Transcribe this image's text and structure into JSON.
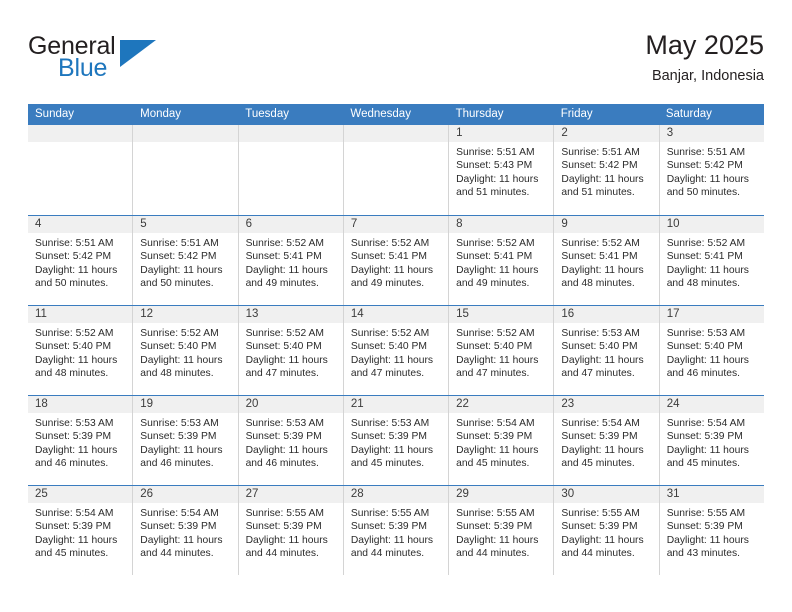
{
  "logo": {
    "word_top": "General",
    "word_bottom": "Blue",
    "flag_icon": "blue-triangle-flag-icon",
    "brand_color": "#1e76bd"
  },
  "header": {
    "title": "May 2025",
    "subtitle": "Banjar, Indonesia"
  },
  "theme": {
    "header_blue": "#3a7cbf",
    "daynum_band": "#f0f0f0",
    "grid_line": "#d4d4d4",
    "text": "#2b2b2b"
  },
  "weekdays": [
    "Sunday",
    "Monday",
    "Tuesday",
    "Wednesday",
    "Thursday",
    "Friday",
    "Saturday"
  ],
  "labels": {
    "sunrise_prefix": "Sunrise:",
    "sunset_prefix": "Sunset:",
    "daylight_prefix": "Daylight:"
  },
  "weeks": [
    [
      {
        "day": "",
        "empty": true
      },
      {
        "day": "",
        "empty": true
      },
      {
        "day": "",
        "empty": true
      },
      {
        "day": "",
        "empty": true
      },
      {
        "day": "1",
        "sunrise": "Sunrise: 5:51 AM",
        "sunset": "Sunset: 5:43 PM",
        "daylight_line1": "Daylight: 11 hours",
        "daylight_line2": "and 51 minutes."
      },
      {
        "day": "2",
        "sunrise": "Sunrise: 5:51 AM",
        "sunset": "Sunset: 5:42 PM",
        "daylight_line1": "Daylight: 11 hours",
        "daylight_line2": "and 51 minutes."
      },
      {
        "day": "3",
        "sunrise": "Sunrise: 5:51 AM",
        "sunset": "Sunset: 5:42 PM",
        "daylight_line1": "Daylight: 11 hours",
        "daylight_line2": "and 50 minutes."
      }
    ],
    [
      {
        "day": "4",
        "sunrise": "Sunrise: 5:51 AM",
        "sunset": "Sunset: 5:42 PM",
        "daylight_line1": "Daylight: 11 hours",
        "daylight_line2": "and 50 minutes."
      },
      {
        "day": "5",
        "sunrise": "Sunrise: 5:51 AM",
        "sunset": "Sunset: 5:42 PM",
        "daylight_line1": "Daylight: 11 hours",
        "daylight_line2": "and 50 minutes."
      },
      {
        "day": "6",
        "sunrise": "Sunrise: 5:52 AM",
        "sunset": "Sunset: 5:41 PM",
        "daylight_line1": "Daylight: 11 hours",
        "daylight_line2": "and 49 minutes."
      },
      {
        "day": "7",
        "sunrise": "Sunrise: 5:52 AM",
        "sunset": "Sunset: 5:41 PM",
        "daylight_line1": "Daylight: 11 hours",
        "daylight_line2": "and 49 minutes."
      },
      {
        "day": "8",
        "sunrise": "Sunrise: 5:52 AM",
        "sunset": "Sunset: 5:41 PM",
        "daylight_line1": "Daylight: 11 hours",
        "daylight_line2": "and 49 minutes."
      },
      {
        "day": "9",
        "sunrise": "Sunrise: 5:52 AM",
        "sunset": "Sunset: 5:41 PM",
        "daylight_line1": "Daylight: 11 hours",
        "daylight_line2": "and 48 minutes."
      },
      {
        "day": "10",
        "sunrise": "Sunrise: 5:52 AM",
        "sunset": "Sunset: 5:41 PM",
        "daylight_line1": "Daylight: 11 hours",
        "daylight_line2": "and 48 minutes."
      }
    ],
    [
      {
        "day": "11",
        "sunrise": "Sunrise: 5:52 AM",
        "sunset": "Sunset: 5:40 PM",
        "daylight_line1": "Daylight: 11 hours",
        "daylight_line2": "and 48 minutes."
      },
      {
        "day": "12",
        "sunrise": "Sunrise: 5:52 AM",
        "sunset": "Sunset: 5:40 PM",
        "daylight_line1": "Daylight: 11 hours",
        "daylight_line2": "and 48 minutes."
      },
      {
        "day": "13",
        "sunrise": "Sunrise: 5:52 AM",
        "sunset": "Sunset: 5:40 PM",
        "daylight_line1": "Daylight: 11 hours",
        "daylight_line2": "and 47 minutes."
      },
      {
        "day": "14",
        "sunrise": "Sunrise: 5:52 AM",
        "sunset": "Sunset: 5:40 PM",
        "daylight_line1": "Daylight: 11 hours",
        "daylight_line2": "and 47 minutes."
      },
      {
        "day": "15",
        "sunrise": "Sunrise: 5:52 AM",
        "sunset": "Sunset: 5:40 PM",
        "daylight_line1": "Daylight: 11 hours",
        "daylight_line2": "and 47 minutes."
      },
      {
        "day": "16",
        "sunrise": "Sunrise: 5:53 AM",
        "sunset": "Sunset: 5:40 PM",
        "daylight_line1": "Daylight: 11 hours",
        "daylight_line2": "and 47 minutes."
      },
      {
        "day": "17",
        "sunrise": "Sunrise: 5:53 AM",
        "sunset": "Sunset: 5:40 PM",
        "daylight_line1": "Daylight: 11 hours",
        "daylight_line2": "and 46 minutes."
      }
    ],
    [
      {
        "day": "18",
        "sunrise": "Sunrise: 5:53 AM",
        "sunset": "Sunset: 5:39 PM",
        "daylight_line1": "Daylight: 11 hours",
        "daylight_line2": "and 46 minutes."
      },
      {
        "day": "19",
        "sunrise": "Sunrise: 5:53 AM",
        "sunset": "Sunset: 5:39 PM",
        "daylight_line1": "Daylight: 11 hours",
        "daylight_line2": "and 46 minutes."
      },
      {
        "day": "20",
        "sunrise": "Sunrise: 5:53 AM",
        "sunset": "Sunset: 5:39 PM",
        "daylight_line1": "Daylight: 11 hours",
        "daylight_line2": "and 46 minutes."
      },
      {
        "day": "21",
        "sunrise": "Sunrise: 5:53 AM",
        "sunset": "Sunset: 5:39 PM",
        "daylight_line1": "Daylight: 11 hours",
        "daylight_line2": "and 45 minutes."
      },
      {
        "day": "22",
        "sunrise": "Sunrise: 5:54 AM",
        "sunset": "Sunset: 5:39 PM",
        "daylight_line1": "Daylight: 11 hours",
        "daylight_line2": "and 45 minutes."
      },
      {
        "day": "23",
        "sunrise": "Sunrise: 5:54 AM",
        "sunset": "Sunset: 5:39 PM",
        "daylight_line1": "Daylight: 11 hours",
        "daylight_line2": "and 45 minutes."
      },
      {
        "day": "24",
        "sunrise": "Sunrise: 5:54 AM",
        "sunset": "Sunset: 5:39 PM",
        "daylight_line1": "Daylight: 11 hours",
        "daylight_line2": "and 45 minutes."
      }
    ],
    [
      {
        "day": "25",
        "sunrise": "Sunrise: 5:54 AM",
        "sunset": "Sunset: 5:39 PM",
        "daylight_line1": "Daylight: 11 hours",
        "daylight_line2": "and 45 minutes."
      },
      {
        "day": "26",
        "sunrise": "Sunrise: 5:54 AM",
        "sunset": "Sunset: 5:39 PM",
        "daylight_line1": "Daylight: 11 hours",
        "daylight_line2": "and 44 minutes."
      },
      {
        "day": "27",
        "sunrise": "Sunrise: 5:55 AM",
        "sunset": "Sunset: 5:39 PM",
        "daylight_line1": "Daylight: 11 hours",
        "daylight_line2": "and 44 minutes."
      },
      {
        "day": "28",
        "sunrise": "Sunrise: 5:55 AM",
        "sunset": "Sunset: 5:39 PM",
        "daylight_line1": "Daylight: 11 hours",
        "daylight_line2": "and 44 minutes."
      },
      {
        "day": "29",
        "sunrise": "Sunrise: 5:55 AM",
        "sunset": "Sunset: 5:39 PM",
        "daylight_line1": "Daylight: 11 hours",
        "daylight_line2": "and 44 minutes."
      },
      {
        "day": "30",
        "sunrise": "Sunrise: 5:55 AM",
        "sunset": "Sunset: 5:39 PM",
        "daylight_line1": "Daylight: 11 hours",
        "daylight_line2": "and 44 minutes."
      },
      {
        "day": "31",
        "sunrise": "Sunrise: 5:55 AM",
        "sunset": "Sunset: 5:39 PM",
        "daylight_line1": "Daylight: 11 hours",
        "daylight_line2": "and 43 minutes."
      }
    ]
  ]
}
